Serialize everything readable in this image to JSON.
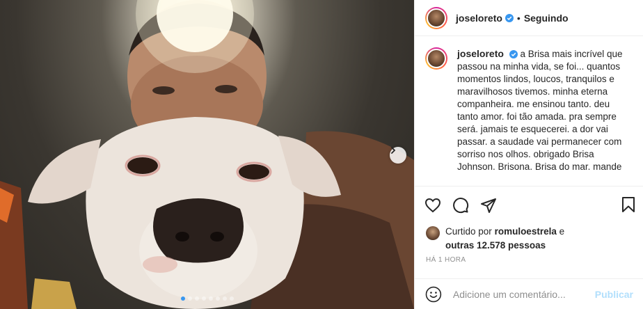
{
  "post": {
    "username": "joseloreto",
    "follow_status": "Seguindo",
    "separator": "•",
    "caption": "a Brisa mais incrível que passou na minha vida, se foi... quantos momentos lindos, loucos, tranquilos e maravilhosos tivemos. minha eterna companheira. me ensinou tanto. deu tanto amor. foi tão amada. pra sempre será. jamais te esquecerei. a dor vai passar. a saudade vai permanecer com sorriso nos olhos. obrigado Brisa Johnson. Brisona. Brisa do mar. mande",
    "likes": {
      "prefix": "Curtido por",
      "user": "romuloestrela",
      "connector": "e",
      "others": "outras 12.578 pessoas"
    },
    "time": "HÁ 1 HORA"
  },
  "carousel": {
    "slide_count": 8,
    "active_index": 0
  },
  "comment_box": {
    "placeholder": "Adicione um comentário...",
    "post_label": "Publicar"
  },
  "icons": {
    "verified": "verified-badge-icon",
    "like": "heart-icon",
    "comment": "comment-icon",
    "share": "share-icon",
    "save": "bookmark-icon",
    "emoji": "emoji-icon",
    "next": "chevron-right-icon"
  },
  "colors": {
    "verified": "#3897f0",
    "publish_disabled": "#b2dffc",
    "active_dot": "#3897f0"
  }
}
